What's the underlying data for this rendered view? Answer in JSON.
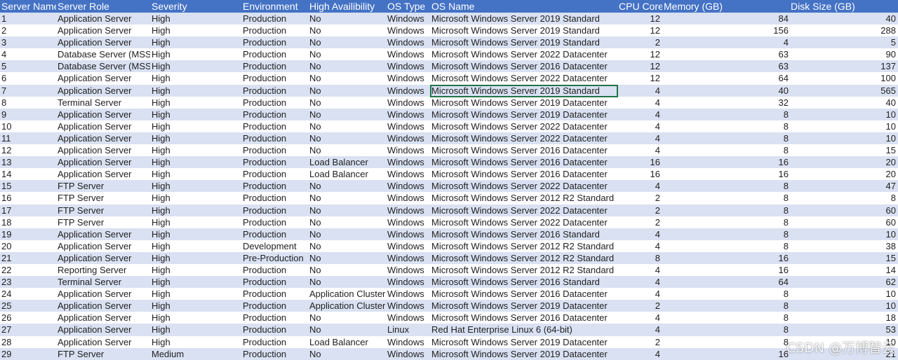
{
  "headers": [
    "Server Name",
    "Server Role",
    "Severity",
    "Environment",
    "High Availibility",
    "OS Type",
    "OS Name",
    "CPU Core",
    "Memory (GB)",
    "Disk Size (GB)"
  ],
  "rows": [
    [
      "1",
      "Application Server",
      "High",
      "Production",
      "No",
      "Windows",
      "Microsoft Windows Server 2019 Standard",
      "12",
      "84",
      "40"
    ],
    [
      "2",
      "Application Server",
      "High",
      "Production",
      "No",
      "Windows",
      "Microsoft Windows Server 2019 Standard",
      "12",
      "156",
      "288"
    ],
    [
      "3",
      "Application Server",
      "High",
      "Production",
      "No",
      "Windows",
      "Microsoft Windows Server 2019 Standard",
      "2",
      "4",
      "5"
    ],
    [
      "4",
      "Database Server (MSSQL)",
      "High",
      "Production",
      "No",
      "Windows",
      "Microsoft Windows Server 2022 Datacenter",
      "12",
      "63",
      "90"
    ],
    [
      "5",
      "Database Server (MSSQL)",
      "High",
      "Production",
      "No",
      "Windows",
      "Microsoft Windows Server 2016 Datacenter",
      "12",
      "63",
      "137"
    ],
    [
      "6",
      "Application Server",
      "High",
      "Production",
      "No",
      "Windows",
      "Microsoft Windows Server 2022 Datacenter",
      "12",
      "64",
      "100"
    ],
    [
      "7",
      "Application Server",
      "High",
      "Production",
      "No",
      "Windows",
      "Microsoft Windows Server 2019 Standard",
      "4",
      "40",
      "565"
    ],
    [
      "8",
      "Terminal Server",
      "High",
      "Production",
      "No",
      "Windows",
      "Microsoft Windows Server 2019 Datacenter",
      "4",
      "32",
      "40"
    ],
    [
      "9",
      "Application Server",
      "High",
      "Production",
      "No",
      "Windows",
      "Microsoft Windows Server 2019 Datacenter",
      "4",
      "8",
      "10"
    ],
    [
      "10",
      "Application Server",
      "High",
      "Production",
      "No",
      "Windows",
      "Microsoft Windows Server 2022 Datacenter",
      "4",
      "8",
      "10"
    ],
    [
      "11",
      "Application Server",
      "High",
      "Production",
      "No",
      "Windows",
      "Microsoft Windows Server 2022 Datacenter",
      "4",
      "8",
      "10"
    ],
    [
      "12",
      "Application Server",
      "High",
      "Production",
      "No",
      "Windows",
      "Microsoft Windows Server 2016 Datacenter",
      "4",
      "8",
      "15"
    ],
    [
      "13",
      "Application Server",
      "High",
      "Production",
      "Load Balancer",
      "Windows",
      "Microsoft Windows Server 2016 Datacenter",
      "16",
      "16",
      "20"
    ],
    [
      "14",
      "Application Server",
      "High",
      "Production",
      "Load Balancer",
      "Windows",
      "Microsoft Windows Server 2016 Datacenter",
      "16",
      "16",
      "20"
    ],
    [
      "15",
      "FTP Server",
      "High",
      "Production",
      "No",
      "Windows",
      "Microsoft Windows Server 2022 Datacenter",
      "4",
      "8",
      "47"
    ],
    [
      "16",
      "FTP Server",
      "High",
      "Production",
      "No",
      "Windows",
      "Microsoft Windows Server 2012 R2 Standard",
      "2",
      "8",
      "8"
    ],
    [
      "17",
      "FTP Server",
      "High",
      "Production",
      "No",
      "Windows",
      "Microsoft Windows Server 2022 Datacenter",
      "2",
      "8",
      "60"
    ],
    [
      "18",
      "FTP Server",
      "High",
      "Production",
      "No",
      "Windows",
      "Microsoft Windows Server 2022 Datacenter",
      "2",
      "8",
      "60"
    ],
    [
      "19",
      "Application Server",
      "High",
      "Production",
      "No",
      "Windows",
      "Microsoft Windows Server 2016 Standard",
      "4",
      "8",
      "10"
    ],
    [
      "20",
      "Application Server",
      "High",
      "Development",
      "No",
      "Windows",
      "Microsoft Windows Server 2012 R2 Standard",
      "4",
      "8",
      "38"
    ],
    [
      "21",
      "Application Server",
      "High",
      "Pre-Production",
      "No",
      "Windows",
      "Microsoft Windows Server 2012 R2 Standard",
      "8",
      "16",
      "15"
    ],
    [
      "22",
      "Reporting Server",
      "High",
      "Production",
      "No",
      "Windows",
      "Microsoft Windows Server 2012 R2 Standard",
      "4",
      "16",
      "14"
    ],
    [
      "23",
      "Terminal Server",
      "High",
      "Production",
      "No",
      "Windows",
      "Microsoft Windows Server 2016 Standard",
      "4",
      "64",
      "62"
    ],
    [
      "24",
      "Application Server",
      "High",
      "Production",
      "Application Cluster",
      "Windows",
      "Microsoft Windows Server 2016 Datacenter",
      "4",
      "8",
      "10"
    ],
    [
      "25",
      "Application Server",
      "High",
      "Production",
      "Application Cluster",
      "Windows",
      "Microsoft Windows Server 2019 Datacenter",
      "2",
      "8",
      "10"
    ],
    [
      "26",
      "Application Server",
      "High",
      "Production",
      "No",
      "Windows",
      "Microsoft Windows Server 2016 Datacenter",
      "4",
      "8",
      "18"
    ],
    [
      "27",
      "Application Server",
      "High",
      "Production",
      "No",
      "Linux",
      "Red Hat Enterprise Linux 6 (64-bit)",
      "4",
      "8",
      "53"
    ],
    [
      "28",
      "Application Server",
      "High",
      "Production",
      "Load Balancer",
      "Windows",
      "Microsoft Windows Server 2019 Datacenter",
      "2",
      "8",
      "10"
    ],
    [
      "29",
      "FTP Server",
      "Medium",
      "Production",
      "No",
      "Windows",
      "Microsoft Windows Server 2019 Datacenter",
      "4",
      "16",
      "21"
    ]
  ],
  "watermark": "CSDN @万博智云",
  "colors": {
    "header_bg": "#4472c4",
    "band_bg": "#d9e1f2",
    "selection_border": "#217346"
  }
}
